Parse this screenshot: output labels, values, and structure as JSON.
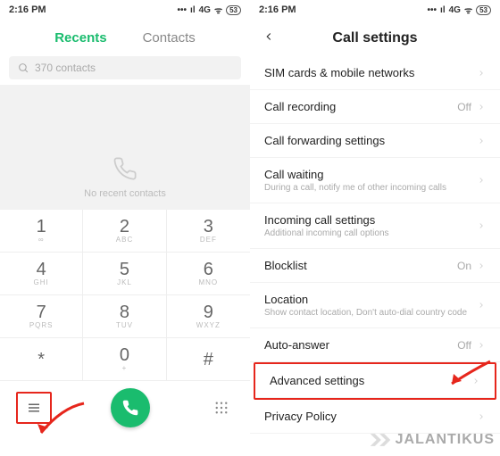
{
  "left": {
    "status": {
      "time": "2:16 PM",
      "net": "4G",
      "batt": "53"
    },
    "tabs": {
      "recents": "Recents",
      "contacts": "Contacts"
    },
    "search": {
      "placeholder": "370 contacts"
    },
    "empty": "No recent contacts",
    "keys": [
      {
        "d": "1",
        "l": "∞"
      },
      {
        "d": "2",
        "l": "ABC"
      },
      {
        "d": "3",
        "l": "DEF"
      },
      {
        "d": "4",
        "l": "GHI"
      },
      {
        "d": "5",
        "l": "JKL"
      },
      {
        "d": "6",
        "l": "MNO"
      },
      {
        "d": "7",
        "l": "PQRS"
      },
      {
        "d": "8",
        "l": "TUV"
      },
      {
        "d": "9",
        "l": "WXYZ"
      },
      {
        "d": "*",
        "l": ""
      },
      {
        "d": "0",
        "l": "+"
      },
      {
        "d": "#",
        "l": ""
      }
    ]
  },
  "right": {
    "status": {
      "time": "2:16 PM",
      "net": "4G",
      "batt": "53"
    },
    "title": "Call settings",
    "items": [
      {
        "label": "SIM cards & mobile networks",
        "sub": "",
        "val": ""
      },
      {
        "label": "Call recording",
        "sub": "",
        "val": "Off"
      },
      {
        "label": "Call forwarding settings",
        "sub": "",
        "val": ""
      },
      {
        "label": "Call waiting",
        "sub": "During a call, notify me of other incoming calls",
        "val": ""
      },
      {
        "label": "Incoming call settings",
        "sub": "Additional incoming call options",
        "val": ""
      },
      {
        "label": "Blocklist",
        "sub": "",
        "val": "On"
      },
      {
        "label": "Location",
        "sub": "Show contact location, Don't auto-dial country code",
        "val": ""
      },
      {
        "label": "Auto-answer",
        "sub": "",
        "val": "Off"
      },
      {
        "label": "Advanced settings",
        "sub": "",
        "val": ""
      },
      {
        "label": "Privacy Policy",
        "sub": "",
        "val": ""
      }
    ]
  },
  "watermark": "JALANTIKUS"
}
